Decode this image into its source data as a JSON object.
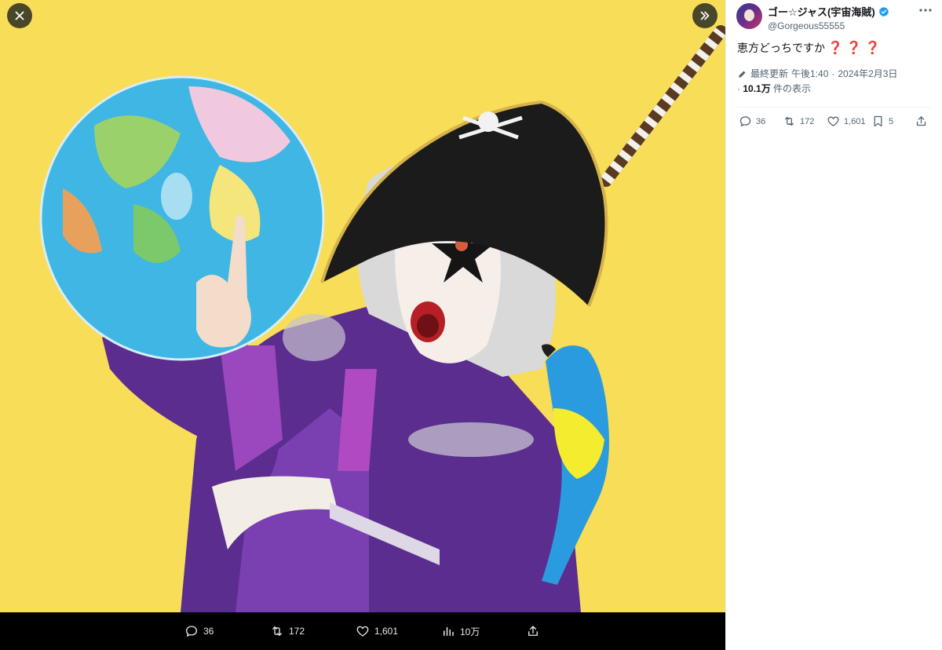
{
  "viewer": {
    "close_icon": "close-icon",
    "expand_icon": "chevrons-right-icon",
    "photo_alt": "",
    "action_bar": {
      "replies": "36",
      "retweets": "172",
      "likes": "1,601",
      "views": "10万"
    }
  },
  "tweet": {
    "author": {
      "display_name": "ゴー☆ジャス(宇宙海賊)",
      "handle": "@Gorgeous55555",
      "verified": true
    },
    "text": "恵方どっちですか",
    "text_emoji": "❓❓❓",
    "meta": {
      "updated_label": "最終更新",
      "time": "午後1:40",
      "separator": "·",
      "date": "2024年2月3日",
      "views_bullet": "·",
      "views_count": "10.1万",
      "views_label": "件の表示"
    },
    "actions": {
      "replies": "36",
      "retweets": "172",
      "likes": "1,601",
      "bookmarks": "5"
    }
  },
  "colors": {
    "background_photo": "#f7dd58",
    "verified_blue": "#1d9bf0",
    "emoji_red": "#d0222a",
    "text_primary": "#0f1419",
    "text_secondary": "#536471"
  }
}
